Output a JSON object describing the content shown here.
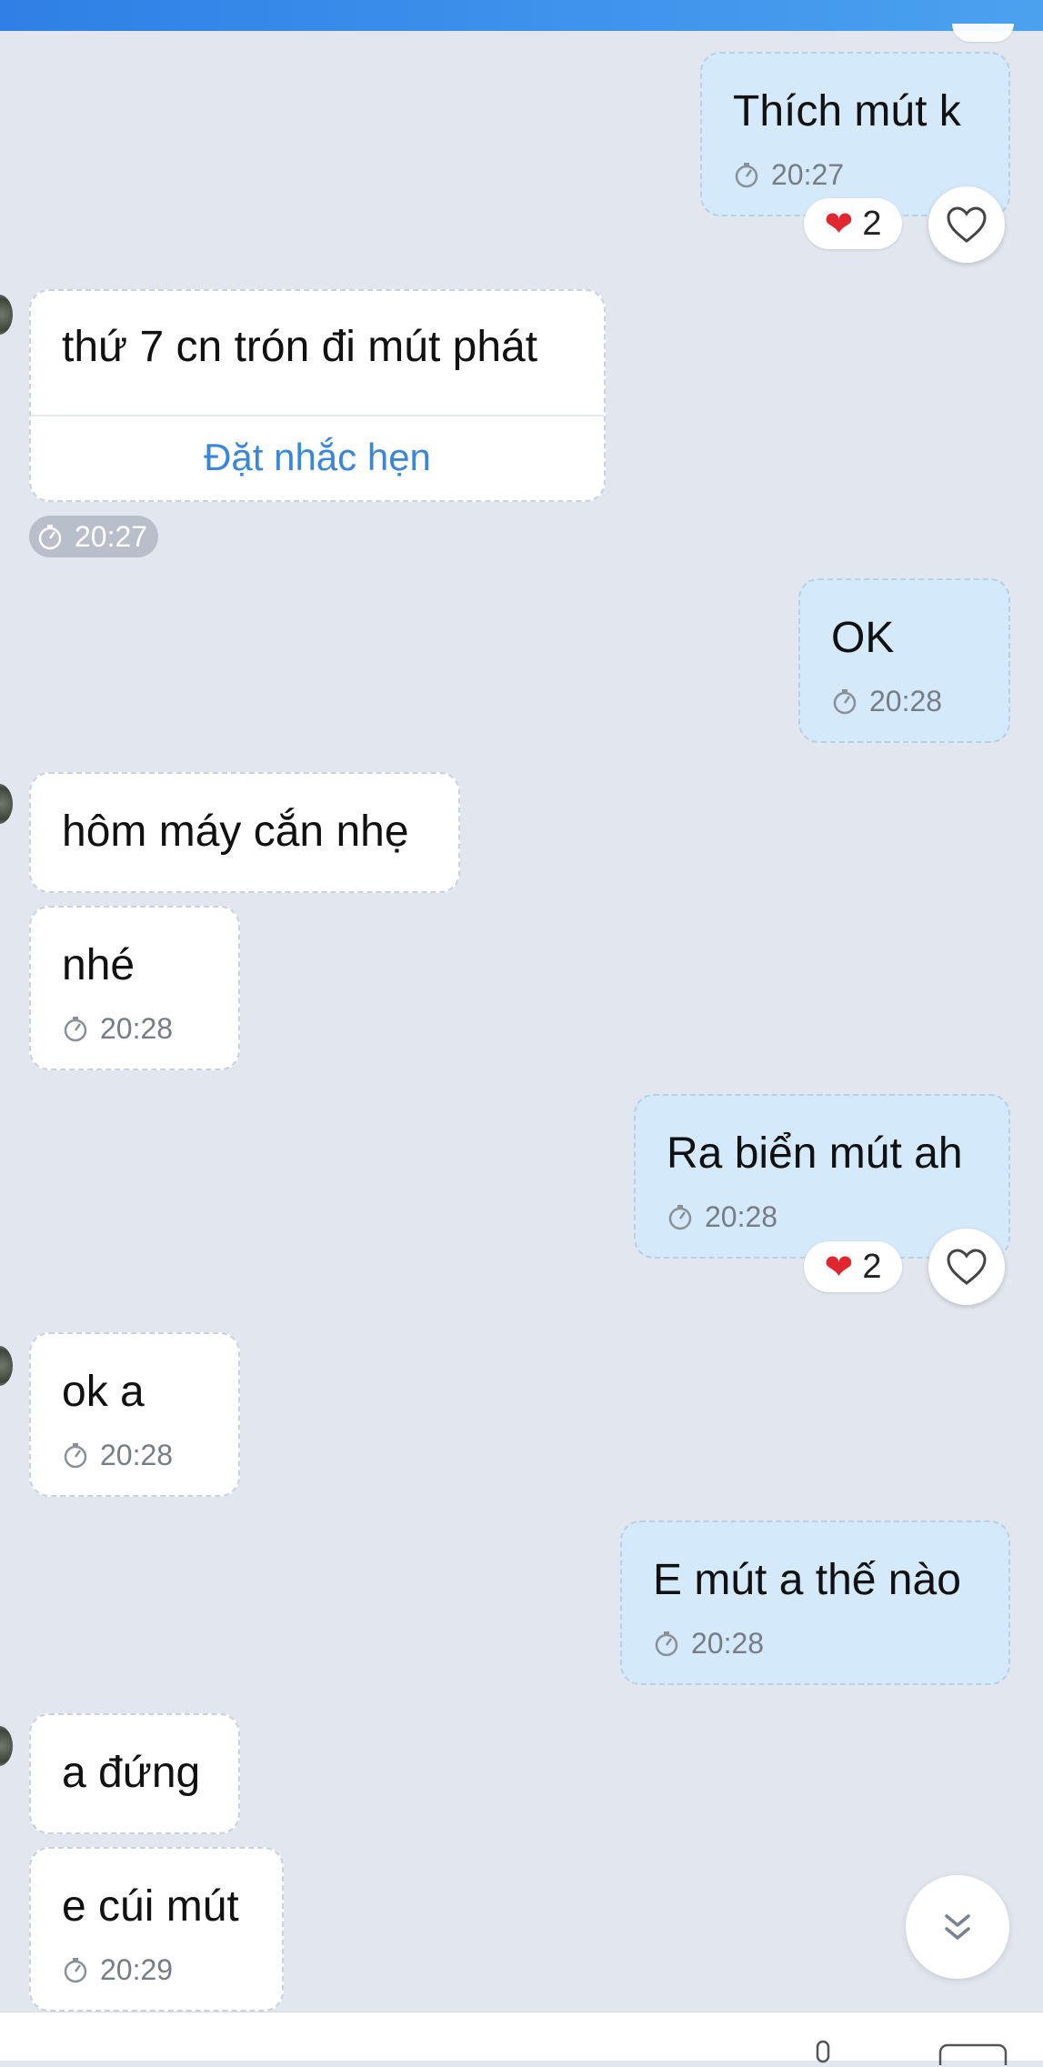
{
  "colors": {
    "header": "#3a8de9",
    "background": "#e2e7ef",
    "incoming_bubble": "#ffffff",
    "outgoing_bubble": "#d4e9fa",
    "reminder_link": "#3b86d8",
    "heart": "#e0262f"
  },
  "messages": [
    {
      "direction": "out",
      "text": "Thích mút k",
      "time": "20:27",
      "reaction": {
        "icon": "heart",
        "count": "2"
      }
    },
    {
      "direction": "in",
      "text": "thứ 7 cn trón đi mút phát",
      "action": "Đặt nhắc hẹn",
      "time": "20:27"
    },
    {
      "direction": "out",
      "text": "OK",
      "time": "20:28"
    },
    {
      "direction": "in",
      "text": "hôm máy cắn nhẹ"
    },
    {
      "direction": "in",
      "text": "nhé",
      "time": "20:28"
    },
    {
      "direction": "out",
      "text": "Ra biển mút ah",
      "time": "20:28",
      "reaction": {
        "icon": "heart",
        "count": "2"
      }
    },
    {
      "direction": "in",
      "text": "ok a",
      "time": "20:28"
    },
    {
      "direction": "out",
      "text": "E mút a thế nào",
      "time": "20:28"
    },
    {
      "direction": "in",
      "text": "a đứng"
    },
    {
      "direction": "in",
      "text": "e cúi mút",
      "time": "20:29"
    }
  ],
  "icons": {
    "timer": "stopwatch-icon",
    "like": "heart-outline-icon",
    "scroll": "double-chevron-down-icon"
  }
}
